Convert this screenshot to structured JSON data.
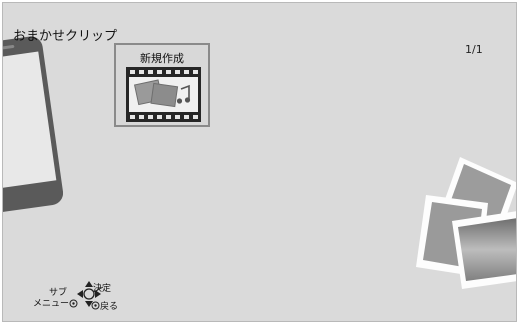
{
  "header": {
    "title": "おまかせクリップ",
    "page_indicator": "1/1"
  },
  "main": {
    "new_item": {
      "label": "新規作成",
      "icon": "film-photo-music-icon"
    }
  },
  "guide": {
    "sub": "サブ",
    "menu": "メニュー",
    "enter": "決定",
    "back": "戻る"
  },
  "colors": {
    "background": "#dadada",
    "selection_border": "#8a8a8a",
    "film": "#262626"
  }
}
